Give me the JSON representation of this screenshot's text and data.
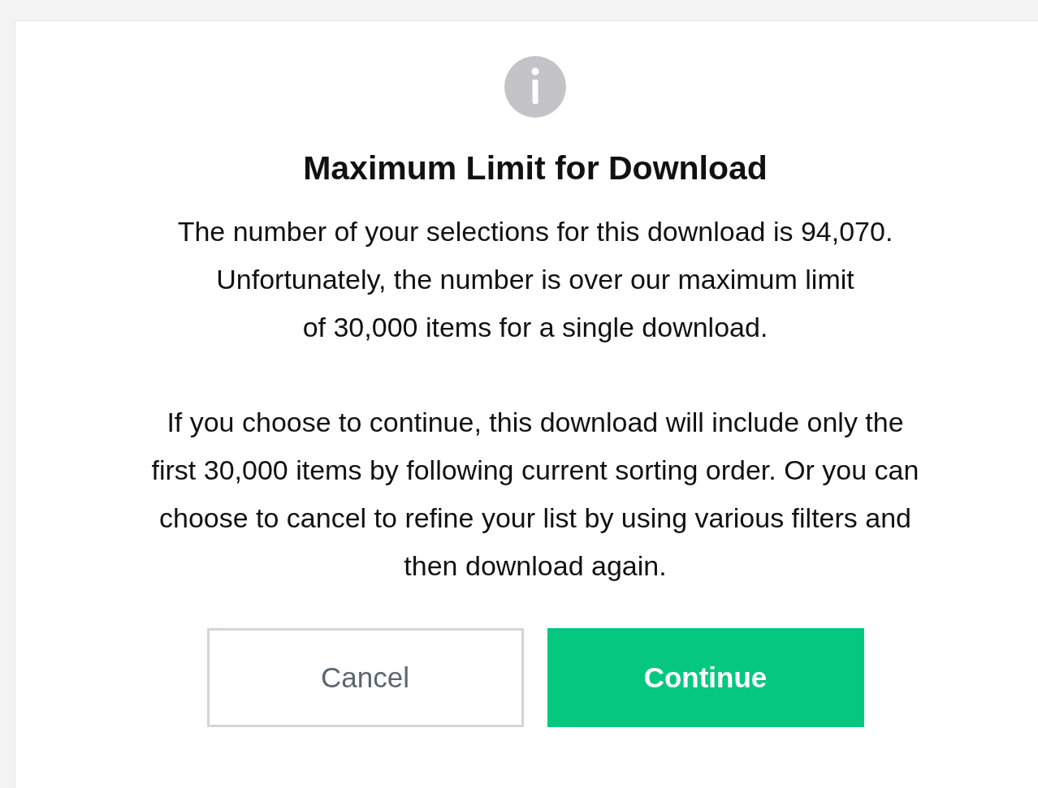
{
  "dialog": {
    "title": "Maximum Limit for Download",
    "paragraphs": [
      [
        "The number of your selections for this download is 94,070.",
        "Unfortunately, the number is over our maximum limit",
        "of 30,000 items for a single download."
      ],
      [
        "If you choose to continue, this download will include only the",
        "first 30,000 items by following current sorting order. Or you can",
        "choose to cancel to refine your list by using various filters and",
        "then download again."
      ]
    ],
    "buttons": [
      {
        "label": "Cancel",
        "kind": "secondary"
      },
      {
        "label": "Continue",
        "kind": "primary"
      }
    ]
  }
}
